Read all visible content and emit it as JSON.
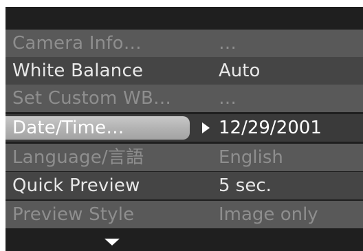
{
  "menu": {
    "items": [
      {
        "label": "Camera Info…",
        "value": "…",
        "state": "disabled",
        "row_color": "#595959"
      },
      {
        "label": "White Balance",
        "value": "Auto",
        "state": "enabled",
        "row_color": "#454545"
      },
      {
        "label": "Set Custom WB…",
        "value": "…",
        "state": "disabled",
        "row_color": "#595959"
      },
      {
        "label": "Date/Time…",
        "value": "12/29/2001",
        "state": "selected",
        "row_color": "#3a3a3a"
      },
      {
        "label": "Language/言語",
        "value": "English",
        "state": "disabled",
        "row_color": "#595959"
      },
      {
        "label": "Quick Preview",
        "value": "5 sec.",
        "state": "enabled",
        "row_color": "#454545"
      },
      {
        "label": "Preview Style",
        "value": "Image only",
        "state": "disabled",
        "row_color": "#595959"
      }
    ]
  },
  "colors": {
    "screen_background": "#1f1f1f",
    "enabled_text": "#e8e8e8",
    "disabled_text": "#8e8e8e",
    "selected_label_text": "#ffffff",
    "selected_value_text": "#ffffff",
    "selection_highlight": "#b8b8b8"
  },
  "icons": {
    "selection_pointer": "triangle-right-icon",
    "scroll_indicator": "chevron-down-icon"
  }
}
